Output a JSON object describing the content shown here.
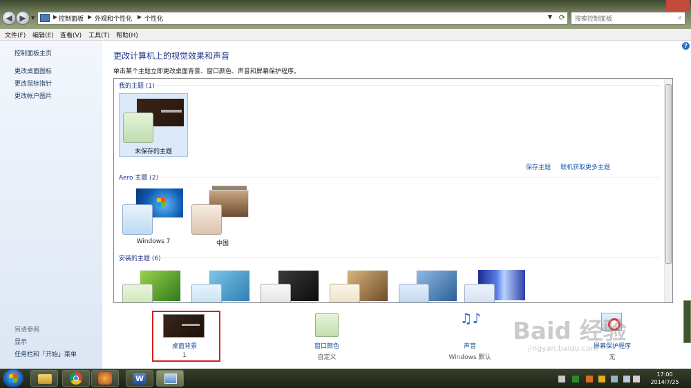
{
  "address": {
    "crumbs": [
      "控制面板",
      "外观和个性化",
      "个性化"
    ],
    "search_placeholder": "搜索控制面板"
  },
  "menu": [
    "文件(F)",
    "编辑(E)",
    "查看(V)",
    "工具(T)",
    "帮助(H)"
  ],
  "sidebar": {
    "links": [
      "控制面板主页",
      "更改桌面图标",
      "更改鼠标指针",
      "更改帐户图片"
    ],
    "see_also_title": "另请参阅",
    "see_also": [
      "显示",
      "任务栏和「开始」菜单"
    ]
  },
  "main": {
    "heading": "更改计算机上的视觉效果和声音",
    "subtext": "单击某个主题立即更改桌面背景、窗口颜色、声音和屏幕保护程序。",
    "help": "?",
    "my_themes": {
      "label": "我的主题 (1)",
      "items": [
        {
          "name": "未保存的主题"
        }
      ],
      "save_link": "保存主题",
      "online_link": "联机获取更多主题"
    },
    "aero_themes": {
      "label": "Aero 主题 (2)",
      "items": [
        {
          "name": "Windows 7"
        },
        {
          "name": "中国"
        }
      ]
    },
    "installed_themes": {
      "label": "安装的主题 (6)"
    }
  },
  "settings": [
    {
      "label": "桌面背景",
      "value": "1"
    },
    {
      "label": "窗口颜色",
      "value": "自定义"
    },
    {
      "label": "声音",
      "value": "Windows 默认"
    },
    {
      "label": "屏幕保护程序",
      "value": "无"
    }
  ],
  "watermark": {
    "big": "Baid 经验",
    "small": "jingyan.baidu.com"
  },
  "clock": {
    "time": "17:00",
    "date": "2014/7/25"
  },
  "colors": {
    "heading": "#1e3287",
    "link": "#1e5eab",
    "highlight_box": "#d71f1f"
  }
}
